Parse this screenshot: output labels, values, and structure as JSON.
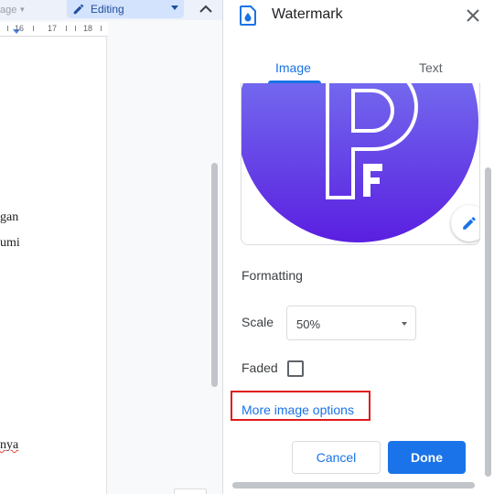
{
  "toolbar": {
    "page_label": "age",
    "mode_label": "Editing"
  },
  "ruler": {
    "ticks": [
      "16",
      "17",
      "18"
    ]
  },
  "document": {
    "fragments": [
      "gan",
      "umi",
      "nya"
    ]
  },
  "panel": {
    "title": "Watermark",
    "tabs": [
      {
        "label": "Image",
        "active": true
      },
      {
        "label": "Text",
        "active": false
      }
    ],
    "preview": {
      "logo_letters": [
        "P",
        "F"
      ],
      "gradient_top": "#7f8df5",
      "gradient_bottom": "#5a1fe0"
    },
    "formatting": {
      "heading": "Formatting",
      "scale_label": "Scale",
      "scale_value": "50%",
      "faded_label": "Faded",
      "faded_checked": false
    },
    "more_link": "More image options",
    "buttons": {
      "cancel": "Cancel",
      "done": "Done"
    }
  },
  "colors": {
    "accent": "#1a73e8",
    "highlight_box": "#e01b1b"
  },
  "icons": [
    "pencil-icon",
    "chevron-up-icon",
    "watermark-doc-icon",
    "close-icon",
    "edit-pencil-icon"
  ]
}
